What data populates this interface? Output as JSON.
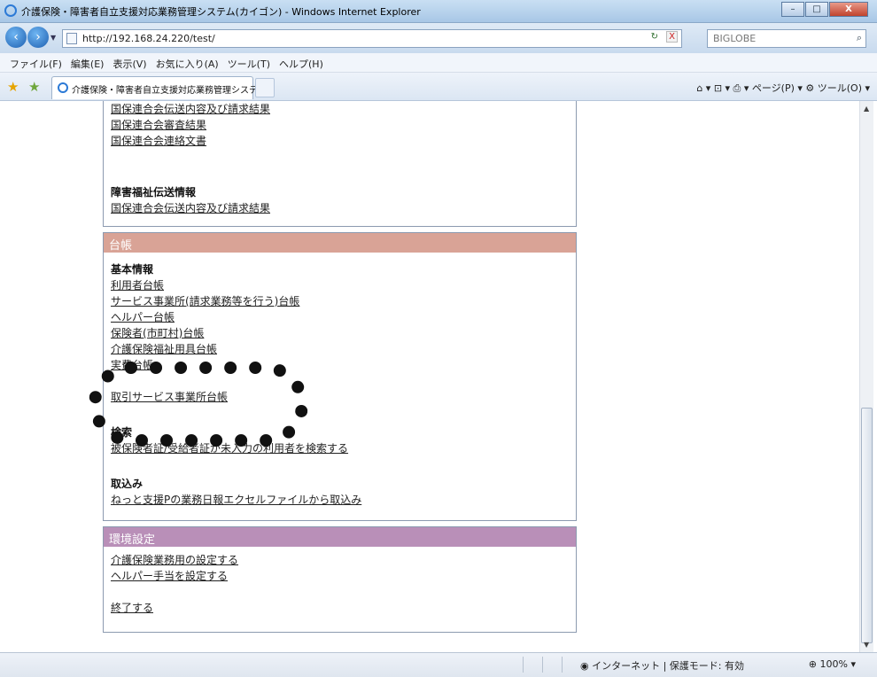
{
  "window": {
    "title": "介護保険・障害者自立支援対応業務管理システム(カイゴン) - Windows Internet Explorer",
    "buttons": {
      "minimize": "–",
      "maximize": "□",
      "close": "X"
    }
  },
  "address": {
    "url": "http://192.168.24.220/test/",
    "search_placeholder": "BIGLOBE",
    "back_icon": "back-arrow-icon",
    "forward_icon": "forward-arrow-icon",
    "refresh_glyph": "↻",
    "stop_glyph": "X",
    "dropdown_glyph": "▼",
    "search_glyph": "⌕"
  },
  "menu": [
    "ファイル(F)",
    "編集(E)",
    "表示(V)",
    "お気に入り(A)",
    "ツール(T)",
    "ヘルプ(H)"
  ],
  "tabs": {
    "active_label": "介護保険・障害者自立支援対応業務管理システ...",
    "star_glyph": "★",
    "toolbar_right": "⌂ ▾  ⊡ ▾  ⎙ ▾  ページ(P) ▾  ⚙ ツール(O) ▾"
  },
  "content": {
    "panel1": {
      "links_top": [
        "国保連合会伝送内容及び請求結果",
        "国保連合会審査結果",
        "国保連合会連絡文書"
      ],
      "section_shogai": "障害福祉伝送情報",
      "links_shogai": [
        "国保連合会伝送内容及び請求結果"
      ]
    },
    "panel2": {
      "header": "台帳",
      "section_kihon": "基本情報",
      "links_kihon": [
        "利用者台帳",
        "サービス事業所(請求業務等を行う)台帳",
        "ヘルパー台帳",
        "保険者(市町村)台帳",
        "介護保険福祉用具台帳",
        "実費台帳"
      ],
      "links_other": [
        "取引サービス事業所台帳"
      ],
      "section_search": "検索",
      "links_search": [
        "被保険者証/受給者証が未入力の利用者を検索する"
      ],
      "section_import": "取込み",
      "links_import": [
        "ねっと支援Pの業務日報エクセルファイルから取込み"
      ]
    },
    "panel3": {
      "header": "環境設定",
      "links": [
        "介護保険業務用の設定する",
        "ヘルパー手当を設定する"
      ],
      "exit": "終了する"
    }
  },
  "status": {
    "zone": "インターネット | 保護モード: 有効",
    "zoom": "100%",
    "zoom_glyph": "⊕",
    "zone_glyph": "◉"
  },
  "colors": {
    "daicho_header": "#d9a396",
    "settings_header": "#b98fb8",
    "panel_border": "#8c9ab0"
  }
}
